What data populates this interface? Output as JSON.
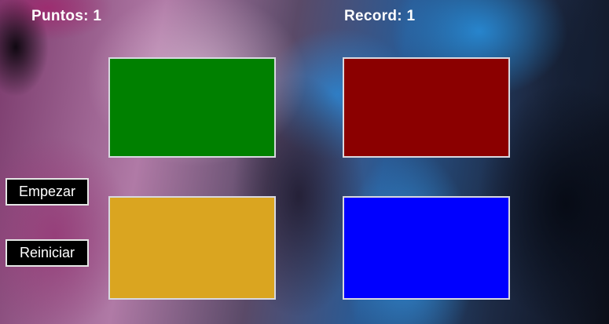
{
  "scoreboard": {
    "points_label": "Puntos: 1",
    "record_label": "Record: 1"
  },
  "buttons": {
    "start_label": "Empezar",
    "reset_label": "Reiniciar"
  },
  "tiles": [
    {
      "name": "green",
      "color": "#008000"
    },
    {
      "name": "red",
      "color": "#8b0000"
    },
    {
      "name": "yellow",
      "color": "#daa520"
    },
    {
      "name": "blue",
      "color": "#0000ff"
    }
  ]
}
